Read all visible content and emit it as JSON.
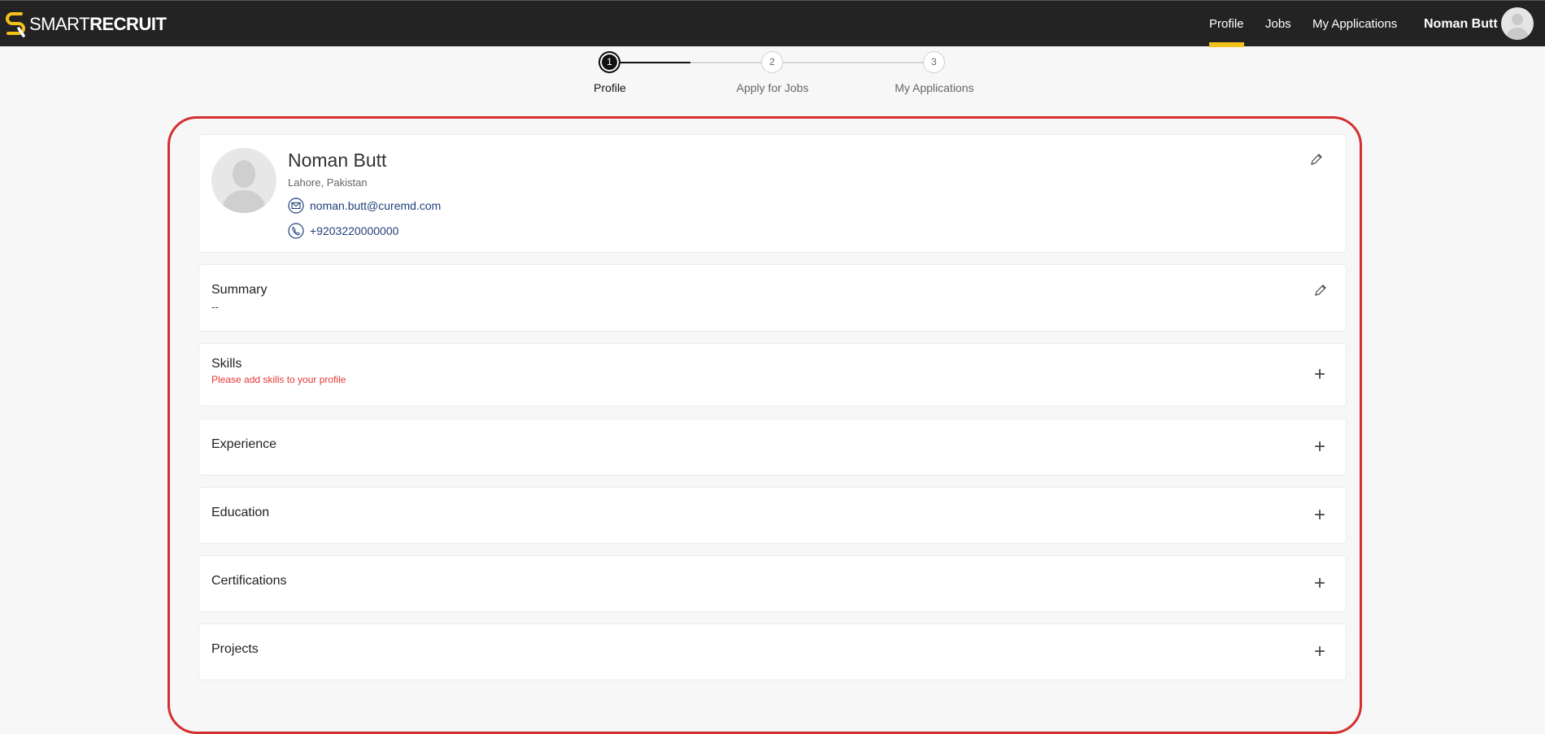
{
  "app": {
    "logo_text_light": "SMART",
    "logo_text_bold": "RECRUIT"
  },
  "nav": {
    "items": [
      {
        "label": "Profile",
        "active": true
      },
      {
        "label": "Jobs",
        "active": false
      },
      {
        "label": "My Applications",
        "active": false
      }
    ],
    "user_name": "Noman Butt"
  },
  "stepper": {
    "steps": [
      {
        "number": "1",
        "label": "Profile",
        "active": true
      },
      {
        "number": "2",
        "label": "Apply for Jobs",
        "active": false
      },
      {
        "number": "3",
        "label": "My Applications",
        "active": false
      }
    ]
  },
  "profile": {
    "name": "Noman Butt",
    "location": "Lahore, Pakistan",
    "email": "noman.butt@curemd.com",
    "phone": "+9203220000000"
  },
  "sections": {
    "summary": {
      "title": "Summary",
      "value": "--"
    },
    "skills": {
      "title": "Skills",
      "hint": "Please add skills to your profile"
    },
    "experience": {
      "title": "Experience"
    },
    "education": {
      "title": "Education"
    },
    "certifications": {
      "title": "Certifications"
    },
    "projects": {
      "title": "Projects"
    }
  },
  "colors": {
    "accent": "#f2c21b",
    "highlight_frame": "#d32f2f",
    "link": "#1f3f7a",
    "warning": "#e53935"
  }
}
